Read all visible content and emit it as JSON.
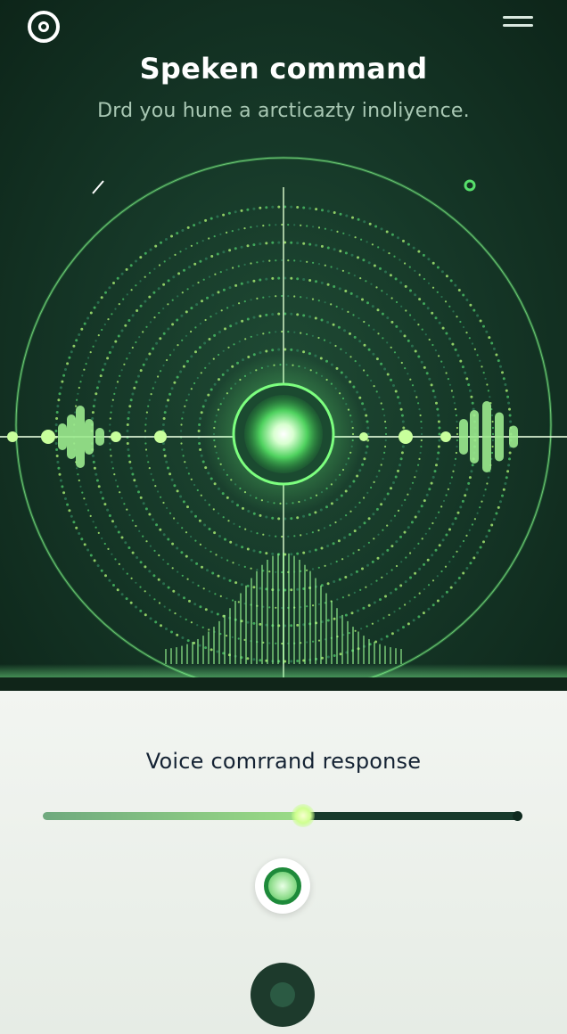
{
  "header": {
    "title": "Speken command",
    "subtitle": "Drd you hune a arcticazty inoliyence."
  },
  "icons": {
    "logo": "target-logo-icon",
    "menu": "hamburger-menu-icon",
    "listen": "mic-ring-icon",
    "record": "record-icon"
  },
  "response": {
    "label": "Voice comrrand response",
    "progress": 0.54
  },
  "colors": {
    "accent_green": "#57e06b",
    "background_dark": "#163828",
    "panel_light": "#f2f5f1"
  }
}
